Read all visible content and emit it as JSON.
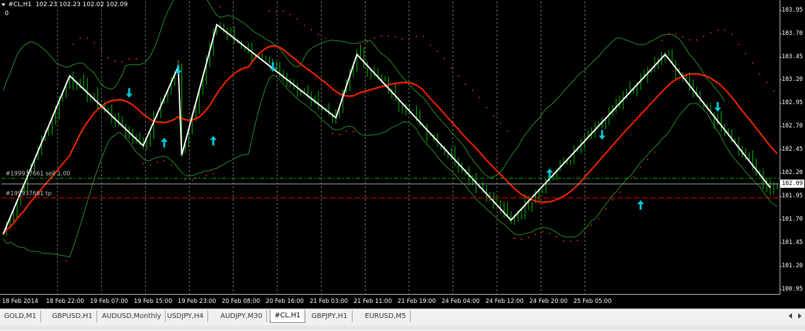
{
  "chart_data": {
    "type": "candlestick",
    "symbol": "#CL,H1",
    "ohlc": "102.23 102.23 102.02 102.09",
    "indicator_window_label": "0",
    "y_range": [
      100.9,
      104.05
    ],
    "price_ticks": [
      "103.95",
      "103.70",
      "103.45",
      "103.20",
      "102.95",
      "102.70",
      "102.45",
      "102.20",
      "101.95",
      "101.70",
      "101.45",
      "101.20",
      "100.95"
    ],
    "current_price": "102.09",
    "x_labels": [
      "18 Feb 2014",
      "18 Feb 22:00",
      "19 Feb 07:00",
      "19 Feb 15:00",
      "19 Feb 23:00",
      "20 Feb 08:00",
      "20 Feb 16:00",
      "21 Feb 03:00",
      "21 Feb 11:00",
      "21 Feb 19:00",
      "24 Feb 04:00",
      "24 Feb 12:00",
      "24 Feb 20:00",
      "25 Feb 05:00"
    ],
    "order_lines": [
      {
        "label": "#199937661 sell 1.00",
        "price": 102.15,
        "color": "#00c000"
      },
      {
        "label": "#199937661 tp",
        "price": 101.94,
        "color": "#ff0000"
      }
    ],
    "zigzag": [
      {
        "i": 0,
        "p": 101.55
      },
      {
        "i": 19,
        "p": 103.25
      },
      {
        "i": 40,
        "p": 102.5
      },
      {
        "i": 50,
        "p": 103.35
      },
      {
        "i": 51,
        "p": 102.4
      },
      {
        "i": 61,
        "p": 103.8
      },
      {
        "i": 95,
        "p": 102.8
      },
      {
        "i": 101,
        "p": 103.48
      },
      {
        "i": 145,
        "p": 101.7
      },
      {
        "i": 189,
        "p": 103.48
      },
      {
        "i": 219,
        "p": 102.05
      }
    ],
    "arrows": [
      {
        "i": 36,
        "p": 103.0,
        "dir": "down"
      },
      {
        "i": 46,
        "p": 102.6,
        "dir": "up"
      },
      {
        "i": 50,
        "p": 103.25,
        "dir": "down"
      },
      {
        "i": 60,
        "p": 102.62,
        "dir": "up"
      },
      {
        "i": 77,
        "p": 103.28,
        "dir": "down"
      },
      {
        "i": 156,
        "p": 102.27,
        "dir": "up"
      },
      {
        "i": 171,
        "p": 102.55,
        "dir": "down"
      },
      {
        "i": 182,
        "p": 101.93,
        "dir": "up"
      },
      {
        "i": 204,
        "p": 102.85,
        "dir": "down"
      }
    ],
    "colors": {
      "candle": "#00c000",
      "zigzag": "#ffffff",
      "ma": "#ff0000",
      "ma_highlight": "#ffff00",
      "bands": "#2f8f2f",
      "sar": "#ff2020",
      "arrow": "#00c8d8",
      "grid": "#c0c0c0"
    }
  },
  "tabs": [
    {
      "label": "GOLD,M1",
      "active": false
    },
    {
      "label": "GBPUSD,H1",
      "active": false
    },
    {
      "label": "AUDUSD,Monthly",
      "active": false
    },
    {
      "label": "USDJPY,H4",
      "active": false
    },
    {
      "label": "AUDJPY,M30",
      "active": false
    },
    {
      "label": "#CL,H1",
      "active": true
    },
    {
      "label": "GBPJPY,H1",
      "active": false
    },
    {
      "label": "EURUSD,M5",
      "active": false
    }
  ]
}
